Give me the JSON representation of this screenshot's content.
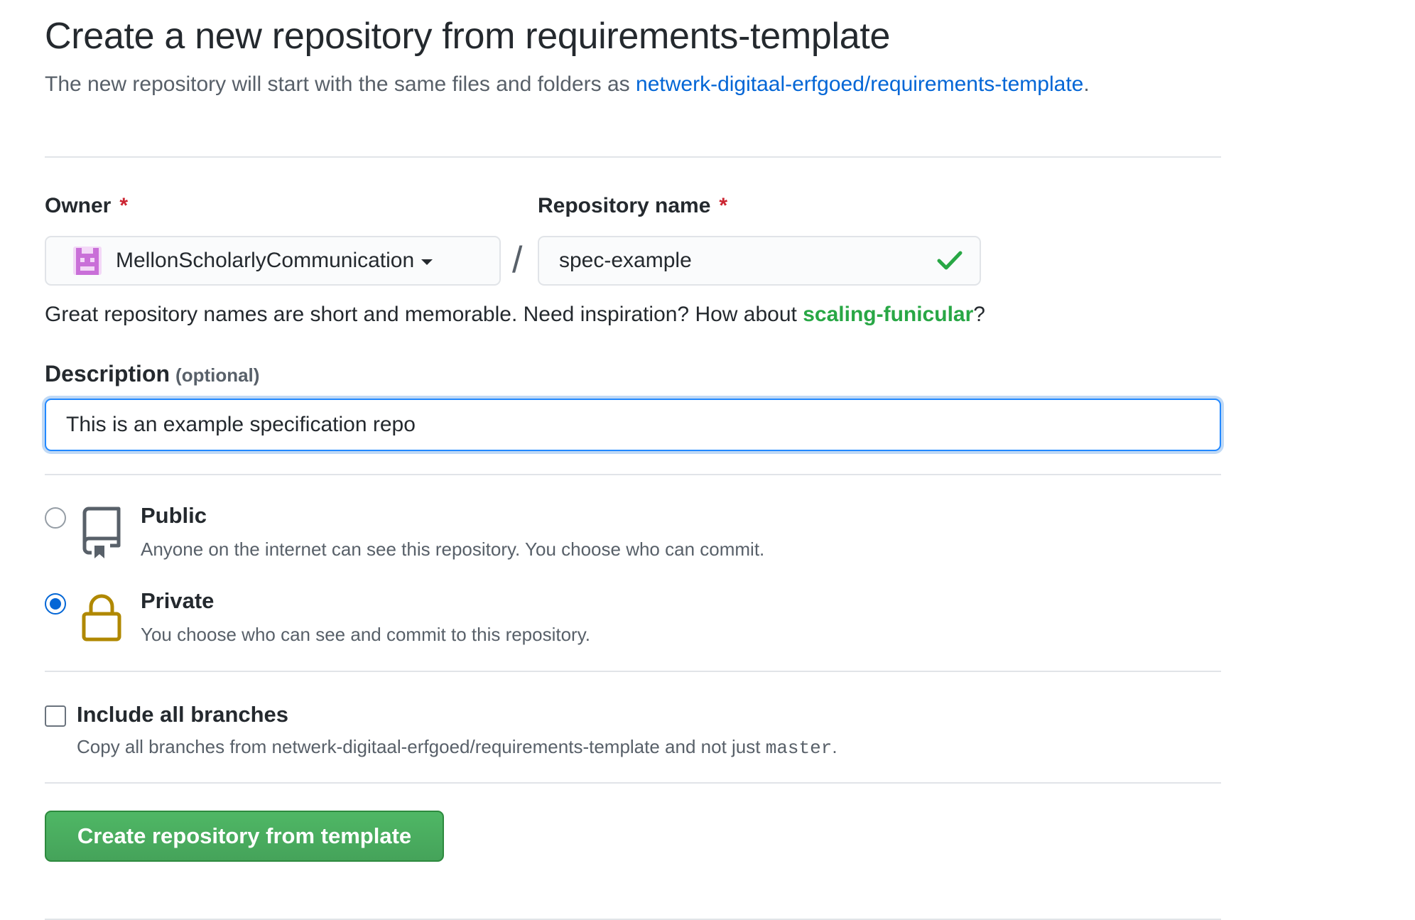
{
  "page": {
    "title": "Create a new repository from requirements-template",
    "subtitle_prefix": "The new repository will start with the same files and folders as ",
    "template_link": "netwerk-digitaal-erfgoed/requirements-template",
    "subtitle_suffix": "."
  },
  "owner": {
    "label": "Owner",
    "required_mark": "*",
    "value": "MellonScholarlyCommunication",
    "avatar_icon": "org-avatar-icon"
  },
  "separator": "/",
  "repo_name": {
    "label": "Repository name",
    "required_mark": "*",
    "value": "spec-example",
    "status_icon": "check-icon"
  },
  "hint": {
    "prefix": "Great repository names are short and memorable. Need inspiration? How about ",
    "suggestion": "scaling-funicular",
    "suffix": "?"
  },
  "description": {
    "label": "Description",
    "optional": "(optional)",
    "value": "This is an example specification repo"
  },
  "visibility": {
    "options": [
      {
        "title": "Public",
        "desc": "Anyone on the internet can see this repository. You choose who can commit.",
        "icon": "repo-icon",
        "selected": false
      },
      {
        "title": "Private",
        "desc": "You choose who can see and commit to this repository.",
        "icon": "lock-icon",
        "selected": true
      }
    ]
  },
  "branches": {
    "label": "Include all branches",
    "desc_prefix": "Copy all branches from netwerk-digitaal-erfgoed/requirements-template and not just ",
    "branch": "master",
    "desc_suffix": ".",
    "checked": false
  },
  "submit": {
    "label": "Create repository from template"
  },
  "colors": {
    "link": "#0366d6",
    "success": "#28a745",
    "required": "#cb2431",
    "button": "#4fb765",
    "lock": "#b08800",
    "avatar": "#c96fd8"
  }
}
